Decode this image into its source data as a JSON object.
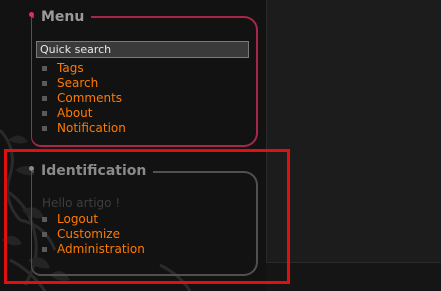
{
  "colors": {
    "background": "#151515",
    "menu_border": "#a8264a",
    "ident_border": "#505050",
    "link": "#ff7a00",
    "highlight": "#e01010"
  },
  "menu": {
    "title": "Menu",
    "search": {
      "placeholder": "Quick search",
      "value": ""
    },
    "items": [
      {
        "label": "Tags"
      },
      {
        "label": "Search"
      },
      {
        "label": "Comments"
      },
      {
        "label": "About"
      },
      {
        "label": "Notification"
      }
    ]
  },
  "identification": {
    "title": "Identification",
    "greeting": "Hello artigo !",
    "items": [
      {
        "label": "Logout"
      },
      {
        "label": "Customize"
      },
      {
        "label": "Administration"
      }
    ]
  }
}
